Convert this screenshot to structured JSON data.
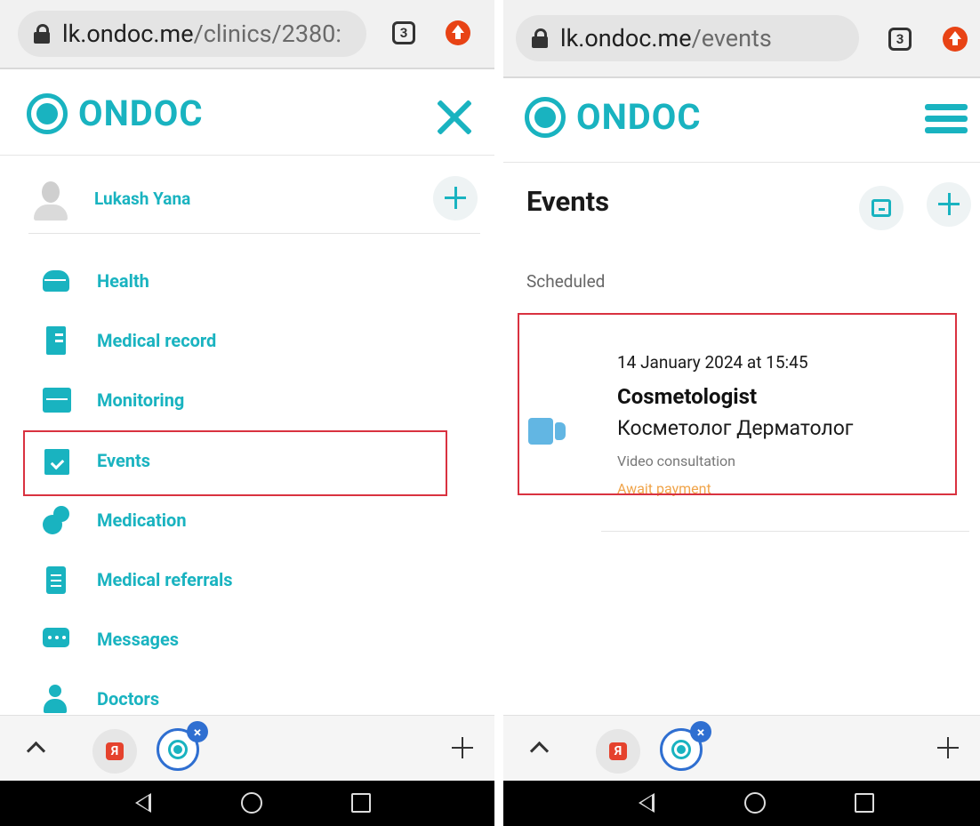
{
  "left_screen": {
    "browser": {
      "url_host": "lk.ondoc.me",
      "url_path": "/clinics/2380:",
      "tab_count": "3"
    },
    "logo_text": "ONDOC",
    "user": {
      "name": "Lukash Yana"
    },
    "menu": [
      {
        "label": "Health",
        "icon": "heart-pulse-icon"
      },
      {
        "label": "Medical record",
        "icon": "medical-record-icon"
      },
      {
        "label": "Monitoring",
        "icon": "monitoring-icon"
      },
      {
        "label": "Events",
        "icon": "calendar-check-icon",
        "highlighted": true
      },
      {
        "label": "Medication",
        "icon": "pills-icon"
      },
      {
        "label": "Medical referrals",
        "icon": "clipboard-icon"
      },
      {
        "label": "Messages",
        "icon": "chat-icon"
      },
      {
        "label": "Doctors",
        "icon": "doctor-icon"
      }
    ]
  },
  "right_screen": {
    "browser": {
      "url_host": "lk.ondoc.me",
      "url_path": "/events",
      "tab_count": "3"
    },
    "logo_text": "ONDOC",
    "page_title": "Events",
    "section_label": "Scheduled",
    "event": {
      "date_time": "14 January 2024 at 15:45",
      "title": "Cosmetologist",
      "subtitle": "Косметолог Дерматолог",
      "type": "Video consultation",
      "status": "Await payment"
    }
  },
  "bottom_bar": {
    "yandex_label": "Я",
    "close_tab_label": "×"
  },
  "colors": {
    "brand": "#19b3c0",
    "highlight": "#d93240",
    "status_pending": "#f0a44a",
    "active_tab": "#2f6fd1"
  }
}
